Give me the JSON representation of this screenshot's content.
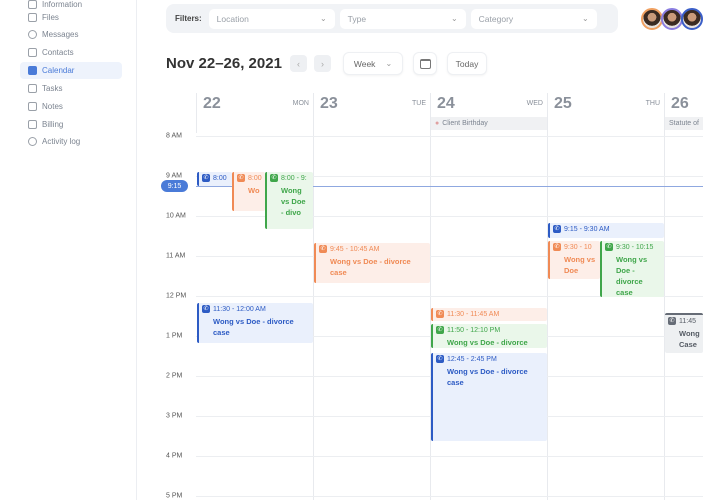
{
  "sidebar": {
    "items": [
      {
        "label": "Information"
      },
      {
        "label": "Files"
      },
      {
        "label": "Messages"
      },
      {
        "label": "Contacts"
      },
      {
        "label": "Calendar",
        "active": true
      },
      {
        "label": "Tasks"
      },
      {
        "label": "Notes"
      },
      {
        "label": "Billing"
      },
      {
        "label": "Activity log"
      }
    ]
  },
  "filters": {
    "label": "Filters:",
    "location": "Location",
    "type": "Type",
    "category": "Category"
  },
  "toolbar": {
    "title": "Nov 22–26, 2021",
    "prev": "‹",
    "next": "›",
    "view": "Week",
    "today": "Today"
  },
  "days": [
    {
      "num": "22",
      "name": "MON"
    },
    {
      "num": "23",
      "name": "TUE"
    },
    {
      "num": "24",
      "name": "WED"
    },
    {
      "num": "25",
      "name": "THU"
    },
    {
      "num": "26",
      "name": ""
    }
  ],
  "allday": {
    "wed": "Client Birthday",
    "fri": "Statute of"
  },
  "hours": [
    "8 AM",
    "9 AM",
    "10 AM",
    "11 AM",
    "12 PM",
    "1 PM",
    "2 PM",
    "3 PM",
    "4 PM",
    "5 PM"
  ],
  "now": "9:15",
  "events": [
    {
      "time": "8:00",
      "title": ""
    },
    {
      "time": "8:00",
      "title": "Wo"
    },
    {
      "time": "8:00 - 9:",
      "title": "Wong vs Doe - divo"
    },
    {
      "time": "11:30 - 12:00 AM",
      "title": "Wong vs Doe - divorce case"
    },
    {
      "time": "9:45 - 10:45 AM",
      "title": "Wong vs Doe - divorce case"
    },
    {
      "time": "11:30 - 11:45 AM",
      "title": ""
    },
    {
      "time": "11:50 - 12:10 PM",
      "title": "Wong vs Doe - divorce"
    },
    {
      "time": "12:45 - 2:45 PM",
      "title": "Wong vs Doe - divorce case"
    },
    {
      "time": "9:15 - 9:30 AM",
      "title": ""
    },
    {
      "time": "9:30 - 10",
      "title": "Wong vs Doe"
    },
    {
      "time": "9:30 - 10:15",
      "title": "Wong vs Doe - divorce case"
    },
    {
      "time": "11:45",
      "title": "Wong Case"
    }
  ],
  "colors": {
    "accent": "#4a7bd8",
    "blue": "#2d5bc4",
    "orange": "#f08a55",
    "green": "#3fa64a"
  }
}
